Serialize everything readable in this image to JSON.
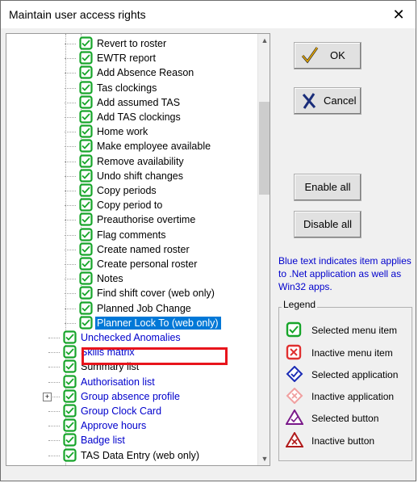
{
  "window": {
    "title": "Maintain user access rights",
    "close_glyph": "✕"
  },
  "tree": {
    "children": [
      {
        "label": "Revert to roster",
        "color": "black"
      },
      {
        "label": "EWTR report",
        "color": "black"
      },
      {
        "label": "Add Absence Reason",
        "color": "black"
      },
      {
        "label": "Tas clockings",
        "color": "black"
      },
      {
        "label": "Add assumed TAS",
        "color": "black"
      },
      {
        "label": "Add TAS clockings",
        "color": "black"
      },
      {
        "label": "Home work",
        "color": "black"
      },
      {
        "label": "Make employee available",
        "color": "black"
      },
      {
        "label": "Remove availability",
        "color": "black"
      },
      {
        "label": "Undo shift changes",
        "color": "black"
      },
      {
        "label": "Copy periods",
        "color": "black"
      },
      {
        "label": "Copy period to",
        "color": "black"
      },
      {
        "label": "Preauthorise overtime",
        "color": "black"
      },
      {
        "label": "Flag comments",
        "color": "black"
      },
      {
        "label": "Create named roster",
        "color": "black"
      },
      {
        "label": "Create personal roster",
        "color": "black"
      },
      {
        "label": "Notes",
        "color": "black"
      },
      {
        "label": "Find shift cover (web only)",
        "color": "black"
      },
      {
        "label": "Planned Job Change",
        "color": "black"
      },
      {
        "label": "Planner Lock To (web only)",
        "color": "white",
        "selected": true
      }
    ],
    "top_level": [
      {
        "label": "Unchecked Anomalies",
        "color": "blue"
      },
      {
        "label": "Skills matrix",
        "color": "blue"
      },
      {
        "label": "Summary list",
        "color": "black"
      },
      {
        "label": "Authorisation list",
        "color": "blue"
      },
      {
        "label": "Group absence profile",
        "color": "blue",
        "expander": "+"
      },
      {
        "label": "Group Clock Card",
        "color": "blue"
      },
      {
        "label": "Approve hours",
        "color": "blue"
      },
      {
        "label": "Badge list",
        "color": "blue"
      },
      {
        "label": "TAS Data Entry (web only)",
        "color": "black"
      }
    ]
  },
  "buttons": {
    "ok": "OK",
    "cancel": "Cancel",
    "enable_all": "Enable all",
    "disable_all": "Disable all"
  },
  "info_text": "Blue text indicates item applies to .Net application as well as Win32 apps.",
  "legend": {
    "title": "Legend",
    "items": [
      {
        "label": "Selected menu item",
        "icon": "green-square-check-icon"
      },
      {
        "label": "Inactive menu item",
        "icon": "red-square-cross-icon"
      },
      {
        "label": "Selected application",
        "icon": "blue-diamond-check-icon"
      },
      {
        "label": "Inactive application",
        "icon": "pink-diamond-cross-icon"
      },
      {
        "label": "Selected button",
        "icon": "purple-triangle-check-icon"
      },
      {
        "label": "Inactive button",
        "icon": "red-triangle-cross-icon"
      }
    ]
  },
  "colors": {
    "blue_text": "#0000cc",
    "selection": "#0078d7",
    "check_green": "#17a52a",
    "highlight_border": "#e8141c"
  }
}
